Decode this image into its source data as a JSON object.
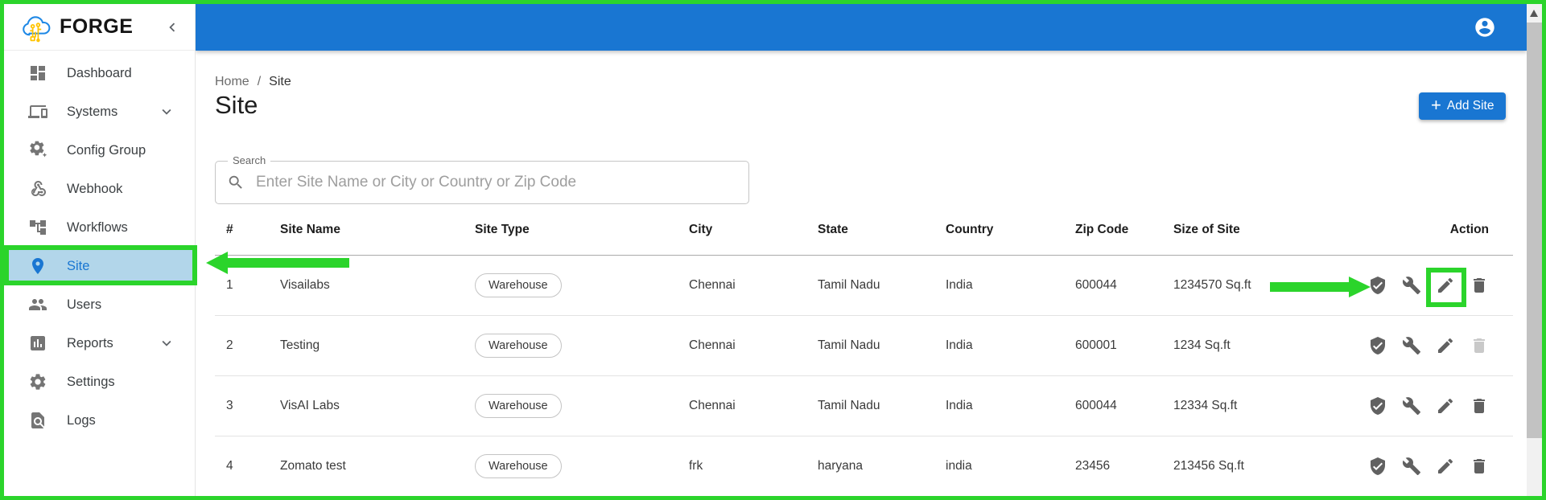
{
  "colors": {
    "primary": "#1976d2",
    "annotation_green": "#2bd42b",
    "selected_item_bg": "#b2d6ea"
  },
  "brand": {
    "name": "FORGE",
    "logo_icon": "cloud-circuit-logo",
    "collapse_icon": "chevron-left-icon"
  },
  "topbar": {
    "account_icon": "account-circle-icon"
  },
  "sidebar": {
    "items": [
      {
        "label": "Dashboard",
        "icon": "dashboard-icon",
        "selected": false,
        "expandable": false
      },
      {
        "label": "Systems",
        "icon": "devices-icon",
        "selected": false,
        "expandable": true
      },
      {
        "label": "Config Group",
        "icon": "config-gear-icon",
        "selected": false,
        "expandable": false
      },
      {
        "label": "Webhook",
        "icon": "webhook-icon",
        "selected": false,
        "expandable": false
      },
      {
        "label": "Workflows",
        "icon": "workflow-icon",
        "selected": false,
        "expandable": false
      },
      {
        "label": "Site",
        "icon": "location-pin-icon",
        "selected": true,
        "expandable": false
      },
      {
        "label": "Users",
        "icon": "people-icon",
        "selected": false,
        "expandable": false
      },
      {
        "label": "Reports",
        "icon": "bar-chart-icon",
        "selected": false,
        "expandable": true
      },
      {
        "label": "Settings",
        "icon": "gear-icon",
        "selected": false,
        "expandable": false
      },
      {
        "label": "Logs",
        "icon": "doc-search-icon",
        "selected": false,
        "expandable": false
      }
    ]
  },
  "breadcrumb": {
    "home": "Home",
    "separator": "/",
    "current": "Site"
  },
  "page": {
    "title": "Site",
    "add_button_label": "Add Site",
    "add_button_plus": "+"
  },
  "search": {
    "label": "Search",
    "placeholder": "Enter Site Name or City or Country or Zip Code",
    "value": ""
  },
  "table": {
    "columns": [
      "#",
      "Site Name",
      "Site Type",
      "City",
      "State",
      "Country",
      "Zip Code",
      "Size of Site",
      "Action"
    ],
    "action_icons": [
      "shield-check",
      "wrench",
      "edit-pencil",
      "trash"
    ],
    "rows": [
      {
        "num": "1",
        "site_name": "Visailabs",
        "site_type": "Warehouse",
        "city": "Chennai",
        "state": "Tamil Nadu",
        "country": "India",
        "zip_code": "600044",
        "size": "1234570 Sq.ft",
        "delete_disabled": false
      },
      {
        "num": "2",
        "site_name": "Testing",
        "site_type": "Warehouse",
        "city": "Chennai",
        "state": "Tamil Nadu",
        "country": "India",
        "zip_code": "600001",
        "size": "1234 Sq.ft",
        "delete_disabled": true
      },
      {
        "num": "3",
        "site_name": "VisAI Labs",
        "site_type": "Warehouse",
        "city": "Chennai",
        "state": "Tamil Nadu",
        "country": "India",
        "zip_code": "600044",
        "size": "12334 Sq.ft",
        "delete_disabled": false
      },
      {
        "num": "4",
        "site_name": "Zomato test",
        "site_type": "Warehouse",
        "city": "frk",
        "state": "haryana",
        "country": "india",
        "zip_code": "23456",
        "size": "213456 Sq.ft",
        "delete_disabled": false
      }
    ]
  }
}
